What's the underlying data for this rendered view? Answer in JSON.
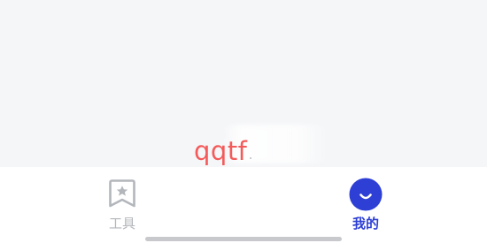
{
  "watermark": {
    "text": "qqtf"
  },
  "tab_bar": {
    "tabs": [
      {
        "id": "tools",
        "label": "工具",
        "icon": "bookmark-star-icon",
        "active": false
      },
      {
        "id": "mine",
        "label": "我的",
        "icon": "smile-circle-icon",
        "active": true
      }
    ]
  },
  "colors": {
    "accent": "#2d3fd4",
    "inactive": "#b3b6bb",
    "watermark": "#f45a5a",
    "background": "#f5f6f8",
    "tab_bar_background": "#ffffff"
  }
}
